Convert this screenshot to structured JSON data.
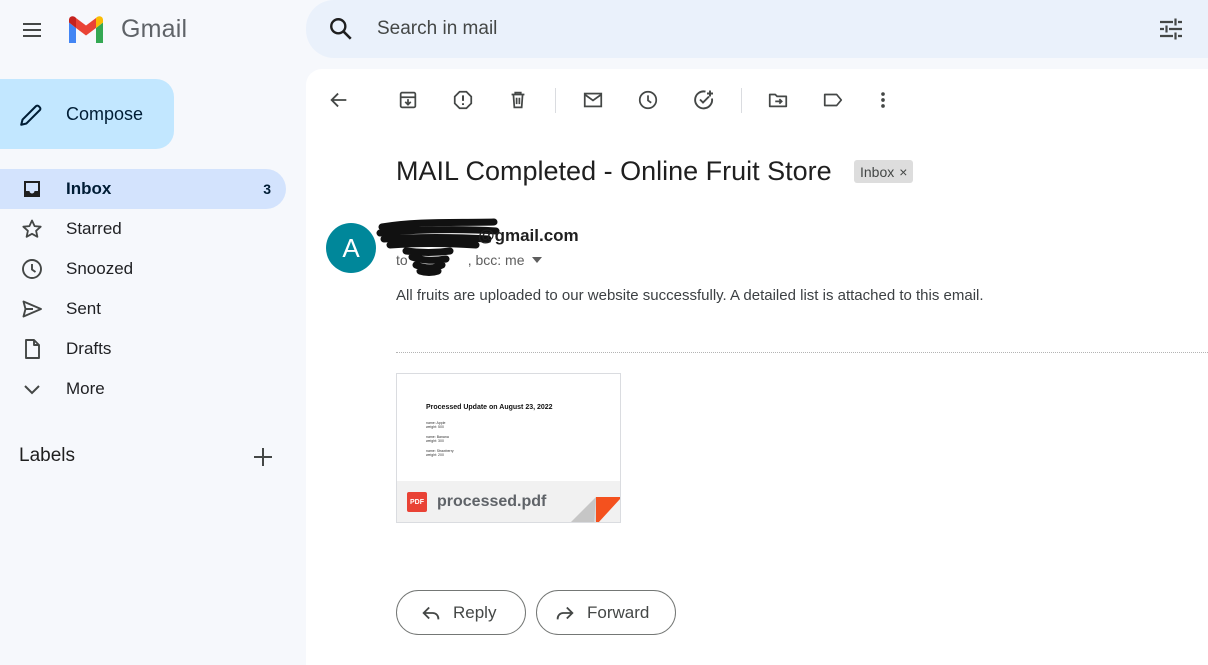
{
  "app": {
    "name": "Gmail"
  },
  "icons": {
    "menu": "hamburger-menu-icon",
    "search": "search-icon",
    "filter": "tune-icon",
    "compose": "pencil-icon"
  },
  "colors": {
    "accent": "#c2e7ff",
    "active_nav": "#d3e3fd",
    "avatar": "#00879a",
    "pdf": "#e94235"
  },
  "search": {
    "placeholder": "Search in mail"
  },
  "compose": {
    "label": "Compose"
  },
  "sidebar": {
    "items": [
      {
        "label": "Inbox",
        "count": "3",
        "icon": "inbox-icon",
        "active": true
      },
      {
        "label": "Starred",
        "icon": "star-icon"
      },
      {
        "label": "Snoozed",
        "icon": "clock-icon"
      },
      {
        "label": "Sent",
        "icon": "send-icon"
      },
      {
        "label": "Drafts",
        "icon": "draft-icon"
      },
      {
        "label": "More",
        "icon": "chevron-down-icon"
      }
    ],
    "labels_heading": "Labels"
  },
  "email": {
    "subject": "MAIL Completed - Online Fruit Store",
    "label_chip": "Inbox",
    "chip_close": "×",
    "avatar_letter": "A",
    "sender": "@gmail.com",
    "to_prefix": "to",
    "to_suffix": ", bcc: me",
    "body": "All fruits are uploaded to our website successfully. A detailed list is attached to this email.",
    "attachment": {
      "preview_title": "Processed Update on August 23, 2022",
      "preview_lines": [
        "name: Apple",
        "weight: 500",
        "name: Banana",
        "weight: 300",
        "name: Strawberry",
        "weight: 200"
      ],
      "file_badge": "PDF",
      "file_name": "processed.pdf"
    }
  },
  "actions": {
    "reply": "Reply",
    "forward": "Forward"
  }
}
